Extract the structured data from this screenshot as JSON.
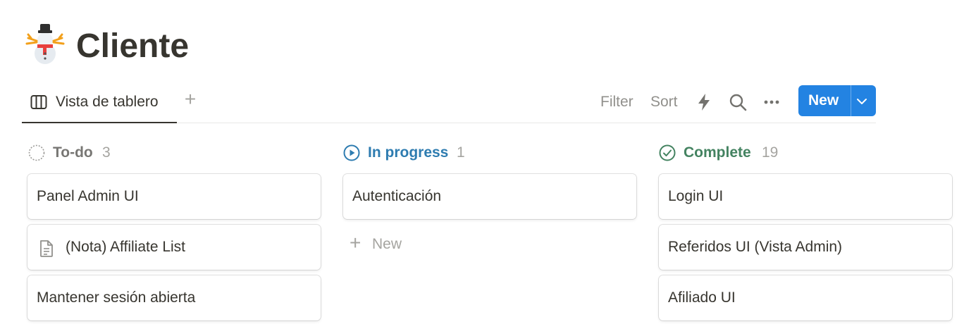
{
  "page": {
    "icon": "snowman-emoji-icon",
    "title": "Cliente"
  },
  "viewbar": {
    "active_view": {
      "label": "Vista de tablero",
      "icon": "board-view-icon"
    },
    "add_view_glyph": "+",
    "filter_label": "Filter",
    "sort_label": "Sort",
    "automation_icon": "lightning-icon",
    "search_icon": "search-icon",
    "more_icon": "more-horizontal-icon",
    "new_button": {
      "label": "New",
      "chevron_icon": "chevron-down-icon"
    }
  },
  "board": {
    "columns": [
      {
        "title": "To-do",
        "count": "3",
        "icon": "todo-dashed-circle-icon",
        "title_color": "#787774",
        "cards": [
          {
            "title": "Panel Admin UI"
          },
          {
            "title": "(Nota) Affiliate List",
            "icon": "document-icon"
          },
          {
            "title": "Mantener sesión abierta"
          }
        ]
      },
      {
        "title": "In progress",
        "count": "1",
        "icon": "play-circle-icon",
        "title_color": "#2e7cb0",
        "cards": [
          {
            "title": "Autenticación"
          }
        ],
        "new_row": {
          "glyph": "+",
          "label": "New"
        }
      },
      {
        "title": "Complete",
        "count": "19",
        "icon": "check-circle-icon",
        "title_color": "#448361",
        "cards": [
          {
            "title": "Login UI"
          },
          {
            "title": "Referidos UI (Vista Admin)"
          },
          {
            "title": "Afiliado UI"
          }
        ]
      }
    ]
  },
  "colors": {
    "accent": "#2383e2",
    "text": "#37352f",
    "muted": "#91908c"
  }
}
